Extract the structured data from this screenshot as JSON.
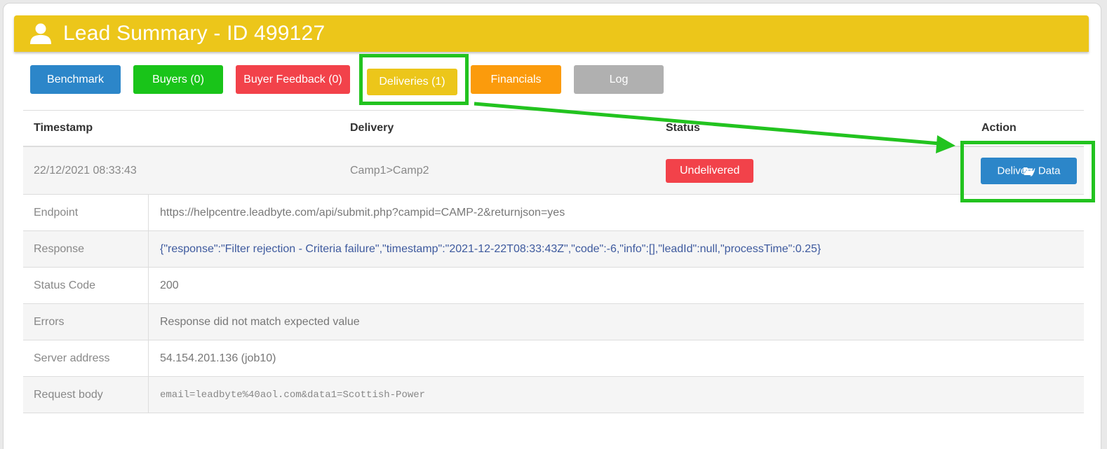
{
  "header": {
    "title": "Lead Summary - ID 499127",
    "icon": "user-icon",
    "color": "#ecc61a"
  },
  "tabs": [
    {
      "label": "Benchmark",
      "color": "#2c86c9"
    },
    {
      "label": "Buyers (0)",
      "color": "#19c419"
    },
    {
      "label": "Buyer Feedback (0)",
      "color": "#f2424a"
    },
    {
      "label": "Deliveries (1)",
      "color": "#ecc61a",
      "active": true
    },
    {
      "label": "Financials",
      "color": "#fb9b0c"
    },
    {
      "label": "Log",
      "color": "#b0b0b0"
    }
  ],
  "table": {
    "columns": [
      "Timestamp",
      "Delivery",
      "Status",
      "Action"
    ],
    "row": {
      "timestamp": "22/12/2021 08:33:43",
      "delivery": "Camp1>Camp2",
      "status": "Undelivered",
      "action_label": "Delivery Data",
      "action_icon": "folder-open-icon"
    }
  },
  "details": [
    {
      "label": "Endpoint",
      "value": "https://helpcentre.leadbyte.com/api/submit.php?campid=CAMP-2&returnjson=yes"
    },
    {
      "label": "Response",
      "value": "{\"response\":\"Filter rejection - Criteria failure\",\"timestamp\":\"2021-12-22T08:33:43Z\",\"code\":-6,\"info\":[],\"leadId\":null,\"processTime\":0.25}"
    },
    {
      "label": "Status Code",
      "value": "200"
    },
    {
      "label": "Errors",
      "value": "Response did not match expected value"
    },
    {
      "label": "Server address",
      "value": "54.154.201.136 (job10)"
    },
    {
      "label": "Request body",
      "value": "email=leadbyte%40aol.com&data1=Scottish-Power"
    }
  ],
  "annotation": {
    "color": "#22c31f"
  }
}
